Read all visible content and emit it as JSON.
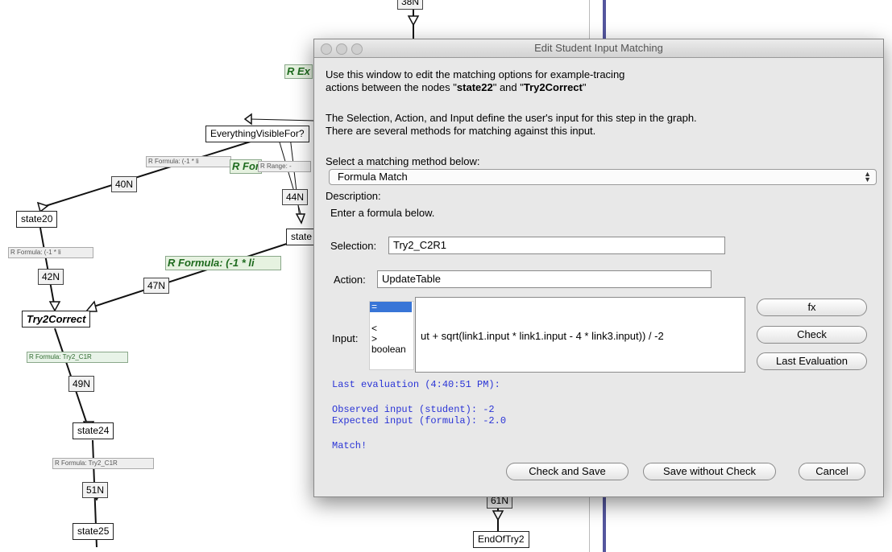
{
  "graph": {
    "nodes": {
      "everything_visible": "EverythingVisibleFor?",
      "state20": "state20",
      "try2correct": "Try2Correct",
      "state24": "state24",
      "state25": "state25",
      "state_partial": "state",
      "end_of_try2": "EndOfTry2"
    },
    "edge_numbers": {
      "n38": "38N",
      "n40": "40N",
      "n42": "42N",
      "n44": "44N",
      "n47": "47N",
      "n49": "49N",
      "n51": "51N",
      "n61": "61N"
    },
    "edge_labels": {
      "r_ex": "R Ex",
      "r_formula_small_1": "R Formula: (-1 * li",
      "r_for": "R For",
      "r_range": "R Range: -",
      "r_formula_small_2": "R Formula: (-1 * li",
      "r_formula_big": "R Formula: (-1 * li",
      "r_formula_try2_1": "R Formula: Try2_C1R",
      "r_formula_try2_2": "R Formula: Try2_C1R"
    }
  },
  "dialog": {
    "title": "Edit Student Input Matching",
    "intro_line1": "Use this window to edit the matching options for example-tracing",
    "intro_line2_a": "actions between the nodes \"",
    "intro_node1": "state22",
    "intro_line2_b": "\" and \"",
    "intro_node2": "Try2Correct",
    "intro_line2_c": "\"",
    "sai_line1": "The Selection, Action, and Input define the user's input for this step in the graph.",
    "sai_line2": "There are several methods for matching against this input.",
    "select_method_label": "Select a matching method below:",
    "method_value": "Formula Match",
    "description_label": "Description:",
    "description_text": "Enter a formula below.",
    "selection_label": "Selection:",
    "selection_value": "Try2_C2R1",
    "action_label": "Action:",
    "action_value": "UpdateTable",
    "input_label": "Input:",
    "operators": [
      "=",
      "<",
      ">",
      "boolean"
    ],
    "formula_value": "ut + sqrt(link1.input * link1.input - 4 * link3.input)) / -2",
    "buttons": {
      "fx": "fx",
      "check": "Check",
      "last_evaluation": "Last Evaluation",
      "check_and_save": "Check and Save",
      "save_without_check": "Save without Check",
      "cancel": "Cancel"
    },
    "evaluation": {
      "header": "Last evaluation (4:40:51 PM):",
      "observed": "Observed input (student): -2",
      "expected": "Expected input (formula): -2.0",
      "result": "Match!"
    }
  }
}
